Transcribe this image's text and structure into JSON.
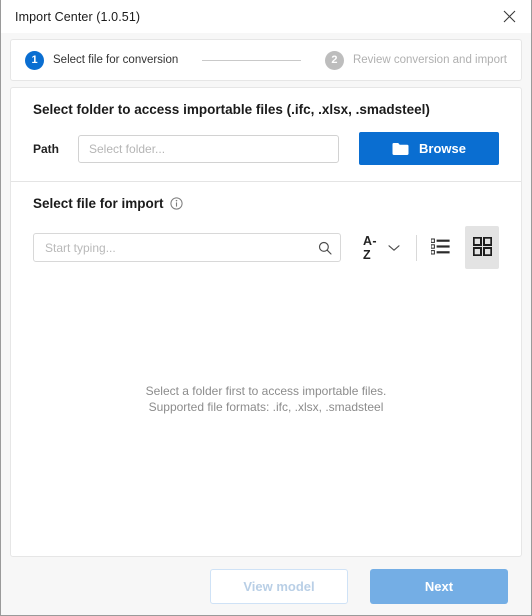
{
  "window": {
    "title": "Import Center (1.0.51)",
    "close_icon": "close-icon"
  },
  "stepper": {
    "steps": [
      {
        "number": "1",
        "label": "Select file for conversion",
        "state": "active"
      },
      {
        "number": "2",
        "label": "Review conversion and import",
        "state": "inactive"
      }
    ]
  },
  "folder_section": {
    "title": "Select folder to access importable files (.ifc, .xlsx, .smadsteel)",
    "path_label": "Path",
    "path_value": "",
    "path_placeholder": "Select folder...",
    "browse_label": "Browse",
    "browse_icon": "folder-icon"
  },
  "file_section": {
    "title": "Select file for import",
    "info_icon": "info-icon",
    "search_value": "",
    "search_placeholder": "Start typing...",
    "search_icon": "search-icon",
    "sort_label": "A-Z",
    "sort_chevron_icon": "chevron-down-icon",
    "view_list_icon": "list-view-icon",
    "view_grid_icon": "grid-view-icon",
    "active_view": "grid",
    "empty_state_line1": "Select a folder first to access importable files.",
    "empty_state_line2": "Supported file formats: .ifc, .xlsx, .smadsteel"
  },
  "footer": {
    "view_model_label": "View model",
    "next_label": "Next"
  },
  "colors": {
    "primary_blue": "#0a6ed1",
    "next_blue": "#74aee5",
    "inactive_gray": "#bdbdbd",
    "window_bg": "#f7f7f7"
  }
}
